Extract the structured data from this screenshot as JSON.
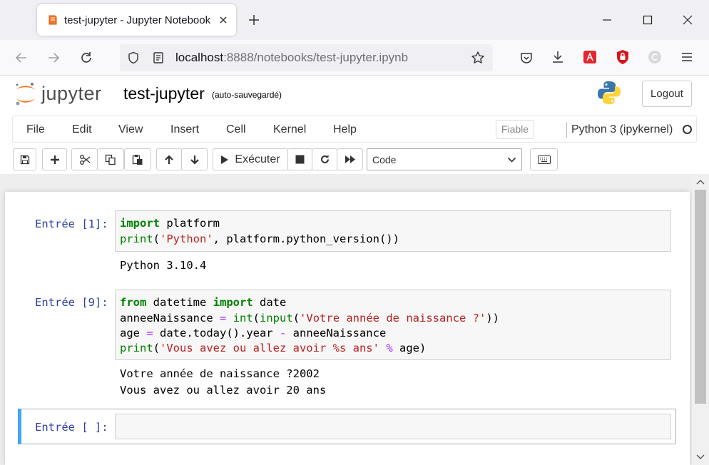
{
  "browser": {
    "tab_title": "test-jupyter - Jupyter Notebook",
    "url_host": "localhost",
    "url_rest": ":8888/notebooks/test-jupyter.ipynb",
    "icons": [
      "jupyter-tab-icon",
      "tab-close-icon",
      "new-tab-icon",
      "minimize-icon",
      "maximize-icon",
      "window-close-icon",
      "back-icon",
      "forward-icon",
      "reload-icon",
      "shield-icon",
      "page-info-icon",
      "bookmark-star-icon",
      "pocket-icon",
      "download-icon",
      "extension-icon",
      "ublock-icon",
      "profile-icon",
      "menu-icon"
    ]
  },
  "header": {
    "logo_text": "jupyter",
    "notebook_title": "test-jupyter",
    "save_status": "(auto-sauvegardé)",
    "logout_label": "Logout"
  },
  "menu": {
    "items": [
      "File",
      "Edit",
      "View",
      "Insert",
      "Cell",
      "Kernel",
      "Help"
    ],
    "trusted_label": "Fiable",
    "kernel_name": "Python 3 (ipykernel)"
  },
  "toolbar": {
    "run_label": "Exécuter",
    "cell_type": "Code",
    "icons": [
      "save-icon",
      "add-cell-icon",
      "cut-icon",
      "copy-icon",
      "paste-icon",
      "move-up-icon",
      "move-down-icon",
      "run-icon",
      "stop-icon",
      "restart-icon",
      "fast-forward-icon",
      "chevron-down-icon",
      "keyboard-icon"
    ]
  },
  "cells": [
    {
      "prompt": "Entrée [1]:",
      "code": [
        [
          {
            "t": "import",
            "c": "kw"
          },
          {
            "t": " platform",
            "c": ""
          }
        ],
        [
          {
            "t": "print",
            "c": "bi"
          },
          {
            "t": "(",
            "c": ""
          },
          {
            "t": "'Python'",
            "c": "st"
          },
          {
            "t": ", platform.python_version())",
            "c": ""
          }
        ]
      ],
      "output": [
        "Python 3.10.4"
      ]
    },
    {
      "prompt": "Entrée [9]:",
      "code": [
        [
          {
            "t": "from",
            "c": "kw"
          },
          {
            "t": " datetime ",
            "c": ""
          },
          {
            "t": "import",
            "c": "kw"
          },
          {
            "t": " date",
            "c": ""
          }
        ],
        [
          {
            "t": "anneeNaissance ",
            "c": ""
          },
          {
            "t": "=",
            "c": "op"
          },
          {
            "t": " ",
            "c": ""
          },
          {
            "t": "int",
            "c": "bi"
          },
          {
            "t": "(",
            "c": ""
          },
          {
            "t": "input",
            "c": "bi"
          },
          {
            "t": "(",
            "c": ""
          },
          {
            "t": "'Votre année de naissance ?'",
            "c": "st"
          },
          {
            "t": "))",
            "c": ""
          }
        ],
        [
          {
            "t": "age ",
            "c": ""
          },
          {
            "t": "=",
            "c": "op"
          },
          {
            "t": " date.today().year ",
            "c": ""
          },
          {
            "t": "-",
            "c": "op"
          },
          {
            "t": " anneeNaissance",
            "c": ""
          }
        ],
        [
          {
            "t": "print",
            "c": "bi"
          },
          {
            "t": "(",
            "c": ""
          },
          {
            "t": "'Vous avez ou allez avoir %s ans'",
            "c": "st"
          },
          {
            "t": " ",
            "c": ""
          },
          {
            "t": "%",
            "c": "op"
          },
          {
            "t": " age)",
            "c": ""
          }
        ]
      ],
      "output": [
        "Votre année de naissance ?2002",
        "Vous avez ou allez avoir 20 ans"
      ]
    },
    {
      "prompt": "Entrée [ ]:",
      "code": [],
      "output": []
    }
  ],
  "colors": {
    "prompt": "#303f9f",
    "keyword": "#008000",
    "string": "#ba2121",
    "operator": "#aa22ff",
    "selected_bar": "#42a5f5"
  }
}
